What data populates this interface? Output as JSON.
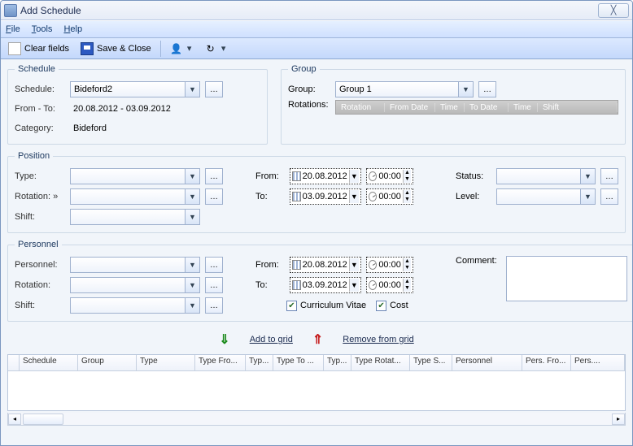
{
  "window": {
    "title": "Add Schedule"
  },
  "menu": {
    "file": "File",
    "tools": "Tools",
    "help": "Help"
  },
  "toolbar": {
    "clear": "Clear fields",
    "save": "Save & Close"
  },
  "schedule": {
    "legend": "Schedule",
    "schedule_label": "Schedule:",
    "schedule_value": "Bideford2",
    "fromto_label": "From - To:",
    "fromto_value": "20.08.2012 - 03.09.2012",
    "category_label": "Category:",
    "category_value": "Bideford"
  },
  "group": {
    "legend": "Group",
    "group_label": "Group:",
    "group_value": "Group 1",
    "rotations_label": "Rotations:",
    "headers": {
      "rotation": "Rotation",
      "from": "From Date",
      "time1": "Time",
      "to": "To Date",
      "time2": "Time",
      "shift": "Shift"
    }
  },
  "position": {
    "legend": "Position",
    "type_label": "Type:",
    "rotation_label": "Rotation: »",
    "shift_label": "Shift:",
    "from_label": "From:",
    "to_label": "To:",
    "from_date": "20.08.2012",
    "to_date": "03.09.2012",
    "from_time": "00:00",
    "to_time": "00:00",
    "status_label": "Status:",
    "level_label": "Level:"
  },
  "personnel": {
    "legend": "Personnel",
    "personnel_label": "Personnel:",
    "rotation_label": "Rotation:",
    "shift_label": "Shift:",
    "from_label": "From:",
    "to_label": "To:",
    "from_date": "20.08.2012",
    "to_date": "03.09.2012",
    "from_time": "00:00",
    "to_time": "00:00",
    "comment_label": "Comment:",
    "cv_label": "Curriculum Vitae",
    "cost_label": "Cost"
  },
  "actions": {
    "add": "Add to grid",
    "remove": "Remove from grid"
  },
  "grid": {
    "headers": [
      "Schedule",
      "Group",
      "Type",
      "Type Fro...",
      "Typ...",
      "Type To ...",
      "Typ...",
      "Type Rotat...",
      "Type S...",
      "Personnel",
      "Pers. Fro...",
      "Pers...."
    ]
  }
}
